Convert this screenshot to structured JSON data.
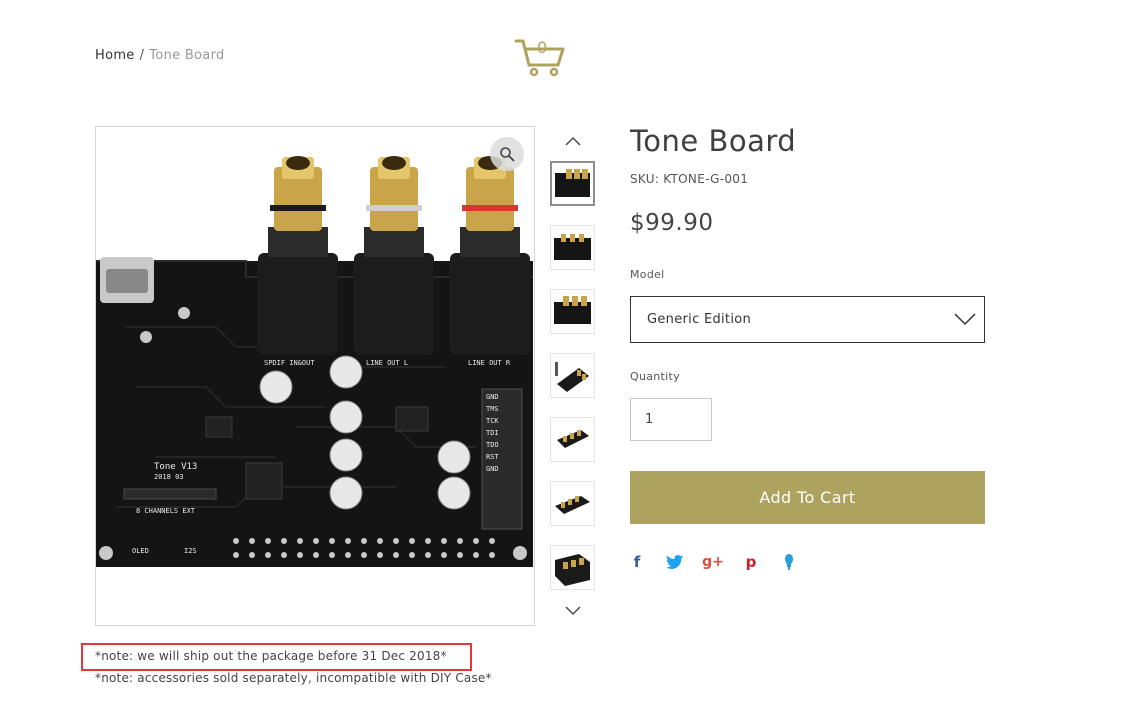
{
  "breadcrumb": {
    "home": "Home",
    "separator": "/",
    "current": "Tone Board"
  },
  "cart": {
    "count": "0",
    "icon": "cart-icon",
    "color": "#ada35f"
  },
  "product": {
    "title": "Tone Board",
    "sku": "SKU: KTONE-G-001",
    "price": "$99.90",
    "model_label": "Model",
    "model_value": "Generic Edition",
    "quantity_label": "Quantity",
    "quantity_value": "1",
    "add_to_cart_label": "Add To Cart",
    "accent_color": "#ada35f"
  },
  "main_image": {
    "board_labels": {
      "spdif": "SPDIF IN&OUT",
      "line_l": "LINE OUT L",
      "line_r": "LINE OUT R",
      "model": "Tone V13",
      "date": "2018 03",
      "ext": "8 CHANNELS EXT",
      "oled": "OLED",
      "i2s": "I2S",
      "pins": [
        "GND",
        "TMS",
        "TCK",
        "TDI",
        "TDO",
        "RST",
        "GND"
      ]
    }
  },
  "thumbnails": {
    "count": 7,
    "selected_index": 0
  },
  "share_icons": [
    "facebook-icon",
    "twitter-icon",
    "google-plus-icon",
    "pinterest-icon",
    "tumblr-icon"
  ],
  "notes": [
    "*note: we will ship out the package before 31 Dec 2018*",
    "*note: accessories sold separately, incompatible with DIY Case*"
  ]
}
